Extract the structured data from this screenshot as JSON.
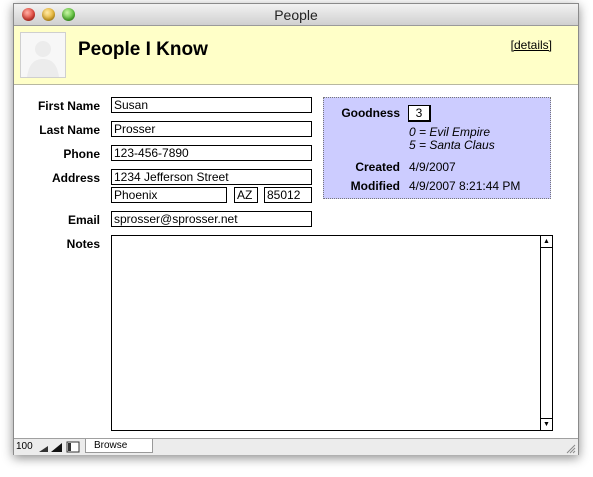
{
  "window": {
    "title": "People"
  },
  "header": {
    "title": "People I Know",
    "details_link": "[details]"
  },
  "form": {
    "first_name": {
      "label": "First Name",
      "value": "Susan"
    },
    "last_name": {
      "label": "Last Name",
      "value": "Prosser"
    },
    "phone": {
      "label": "Phone",
      "value": "123-456-7890"
    },
    "address": {
      "label": "Address",
      "street": "1234 Jefferson Street",
      "city": "Phoenix",
      "state": "AZ",
      "zip": "85012"
    },
    "email": {
      "label": "Email",
      "value": "sprosser@sprosser.net"
    },
    "notes": {
      "label": "Notes",
      "value": ""
    }
  },
  "info": {
    "goodness_label": "Goodness",
    "goodness_value": "3",
    "goodness_hint_1": "0 = Evil Empire",
    "goodness_hint_2": "5 = Santa Claus",
    "created_label": "Created",
    "created_value": "4/9/2007",
    "modified_label": "Modified",
    "modified_value": "4/9/2007 8:21:44 PM"
  },
  "statusbar": {
    "zoom": "100",
    "mode": "Browse"
  }
}
